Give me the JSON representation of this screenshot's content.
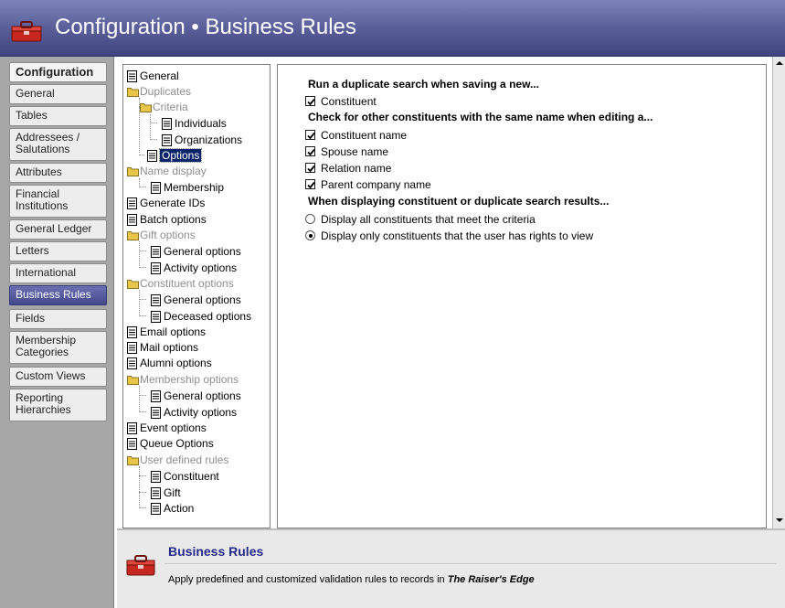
{
  "header": {
    "title": "Configuration • Business Rules",
    "icon": "toolbox-icon"
  },
  "nav": {
    "items": [
      {
        "label": "Configuration",
        "state": "header"
      },
      {
        "label": "General"
      },
      {
        "label": "Tables"
      },
      {
        "label": "Addressees / Salutations"
      },
      {
        "label": "Attributes"
      },
      {
        "label": "Financial Institutions"
      },
      {
        "label": "General Ledger"
      },
      {
        "label": "Letters"
      },
      {
        "label": "International"
      },
      {
        "label": "Business Rules",
        "state": "active"
      },
      {
        "label": "Fields"
      },
      {
        "label": "Membership Categories"
      },
      {
        "label": "Custom Views"
      },
      {
        "label": "Reporting Hierarchies"
      }
    ]
  },
  "tree": {
    "nodes": [
      {
        "label": "General",
        "type": "doc"
      },
      {
        "label": "Duplicates",
        "type": "folder"
      },
      {
        "label": "Criteria",
        "type": "folder"
      },
      {
        "label": "Individuals",
        "type": "doc"
      },
      {
        "label": "Organizations",
        "type": "doc"
      },
      {
        "label": "Options",
        "type": "doc",
        "selected": true
      },
      {
        "label": "Name display",
        "type": "folder"
      },
      {
        "label": "Membership",
        "type": "doc"
      },
      {
        "label": "Generate IDs",
        "type": "doc"
      },
      {
        "label": "Batch options",
        "type": "doc"
      },
      {
        "label": "Gift options",
        "type": "folder"
      },
      {
        "label": "General options",
        "type": "doc"
      },
      {
        "label": "Activity options",
        "type": "doc"
      },
      {
        "label": "Constituent options",
        "type": "folder"
      },
      {
        "label": "General options",
        "type": "doc"
      },
      {
        "label": "Deceased options",
        "type": "doc"
      },
      {
        "label": "Email options",
        "type": "doc"
      },
      {
        "label": "Mail options",
        "type": "doc"
      },
      {
        "label": "Alumni options",
        "type": "doc"
      },
      {
        "label": "Membership options",
        "type": "folder"
      },
      {
        "label": "General options",
        "type": "doc"
      },
      {
        "label": "Activity options",
        "type": "doc"
      },
      {
        "label": "Event options",
        "type": "doc"
      },
      {
        "label": "Queue Options",
        "type": "doc"
      },
      {
        "label": "User defined rules",
        "type": "folder"
      },
      {
        "label": "Constituent",
        "type": "doc"
      },
      {
        "label": "Gift",
        "type": "doc"
      },
      {
        "label": "Action",
        "type": "doc"
      }
    ]
  },
  "options": {
    "section1_heading": "Run a duplicate search when saving a new...",
    "section1_items": [
      {
        "label": "Constituent",
        "checked": true
      }
    ],
    "section2_heading": "Check for other constituents with the same name when editing a...",
    "section2_items": [
      {
        "label": "Constituent name",
        "checked": true
      },
      {
        "label": "Spouse name",
        "checked": true
      },
      {
        "label": "Relation name",
        "checked": true
      },
      {
        "label": "Parent company name",
        "checked": true
      }
    ],
    "section3_heading": "When displaying constituent or duplicate search results...",
    "section3_items": [
      {
        "label": "Display all constituents that meet the criteria",
        "selected": false
      },
      {
        "label": "Display only constituents that the user has rights to view",
        "selected": true
      }
    ]
  },
  "footer": {
    "title": "Business Rules",
    "description_prefix": "Apply predefined and customized validation rules to records in ",
    "description_emphasis": "The Raiser's Edge",
    "icon": "toolbox-icon"
  }
}
